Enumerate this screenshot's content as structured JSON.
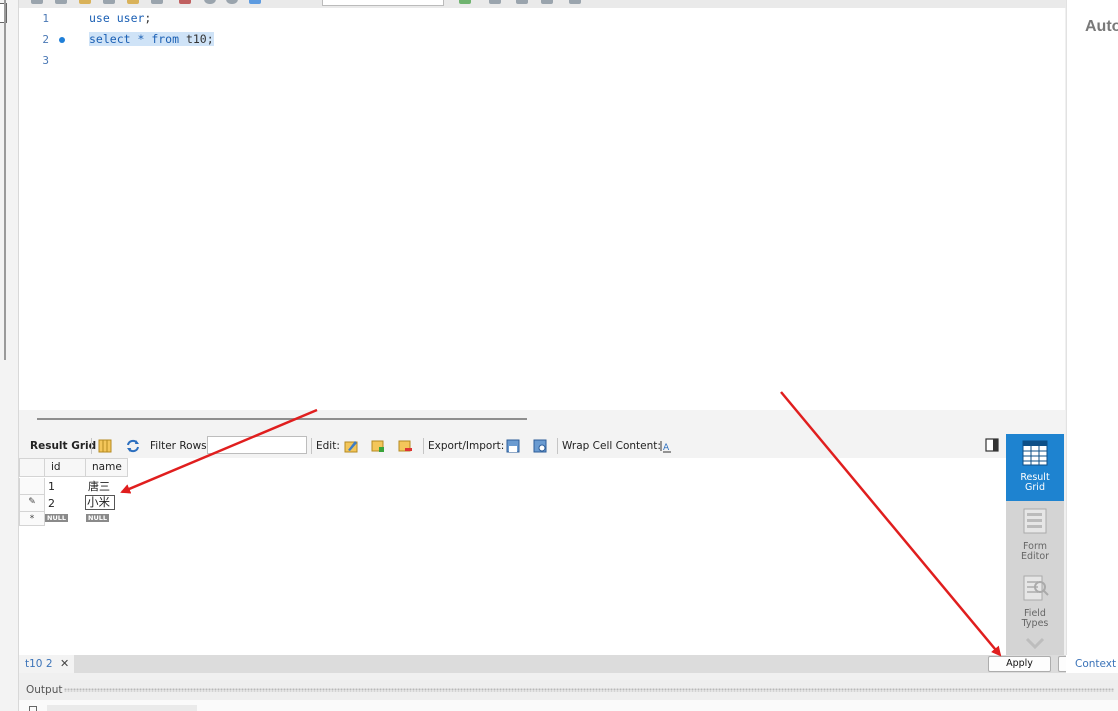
{
  "right_panel": {
    "title": "Auto"
  },
  "editor": {
    "line_numbers": [
      "1",
      "2",
      "3"
    ],
    "line1": {
      "kw1": "use",
      "kw2": "user",
      "rest": ";"
    },
    "line2": {
      "kw1": "select",
      "star": " * ",
      "kw2": "from",
      "rest": " t10;"
    }
  },
  "result_toolbar": {
    "result_grid": "Result Grid",
    "filter_rows": "Filter Rows:",
    "filter_value": "",
    "edit": "Edit:",
    "export_import": "Export/Import:",
    "wrap_cell": "Wrap Cell Content:"
  },
  "grid": {
    "columns": [
      "id",
      "name"
    ],
    "rows": [
      {
        "id": "1",
        "name": "唐三"
      },
      {
        "id": "2",
        "name": "小米"
      }
    ],
    "null_label": "NULL",
    "new_row_marker": "*",
    "edit_marker": "✎"
  },
  "side_panel": {
    "result_grid": [
      "Result",
      "Grid"
    ],
    "form_editor": [
      "Form",
      "Editor"
    ],
    "field_types": [
      "Field",
      "Types"
    ]
  },
  "bottom": {
    "tab_label": "t10 2",
    "tab_close": "✕",
    "apply": "Apply",
    "context": "Context"
  },
  "output": {
    "label": "Output"
  },
  "colors": {
    "accent": "#1e83d0",
    "keyword": "#1a5fb4",
    "selection": "#cfe3f7",
    "arrow": "#e01e1e"
  }
}
